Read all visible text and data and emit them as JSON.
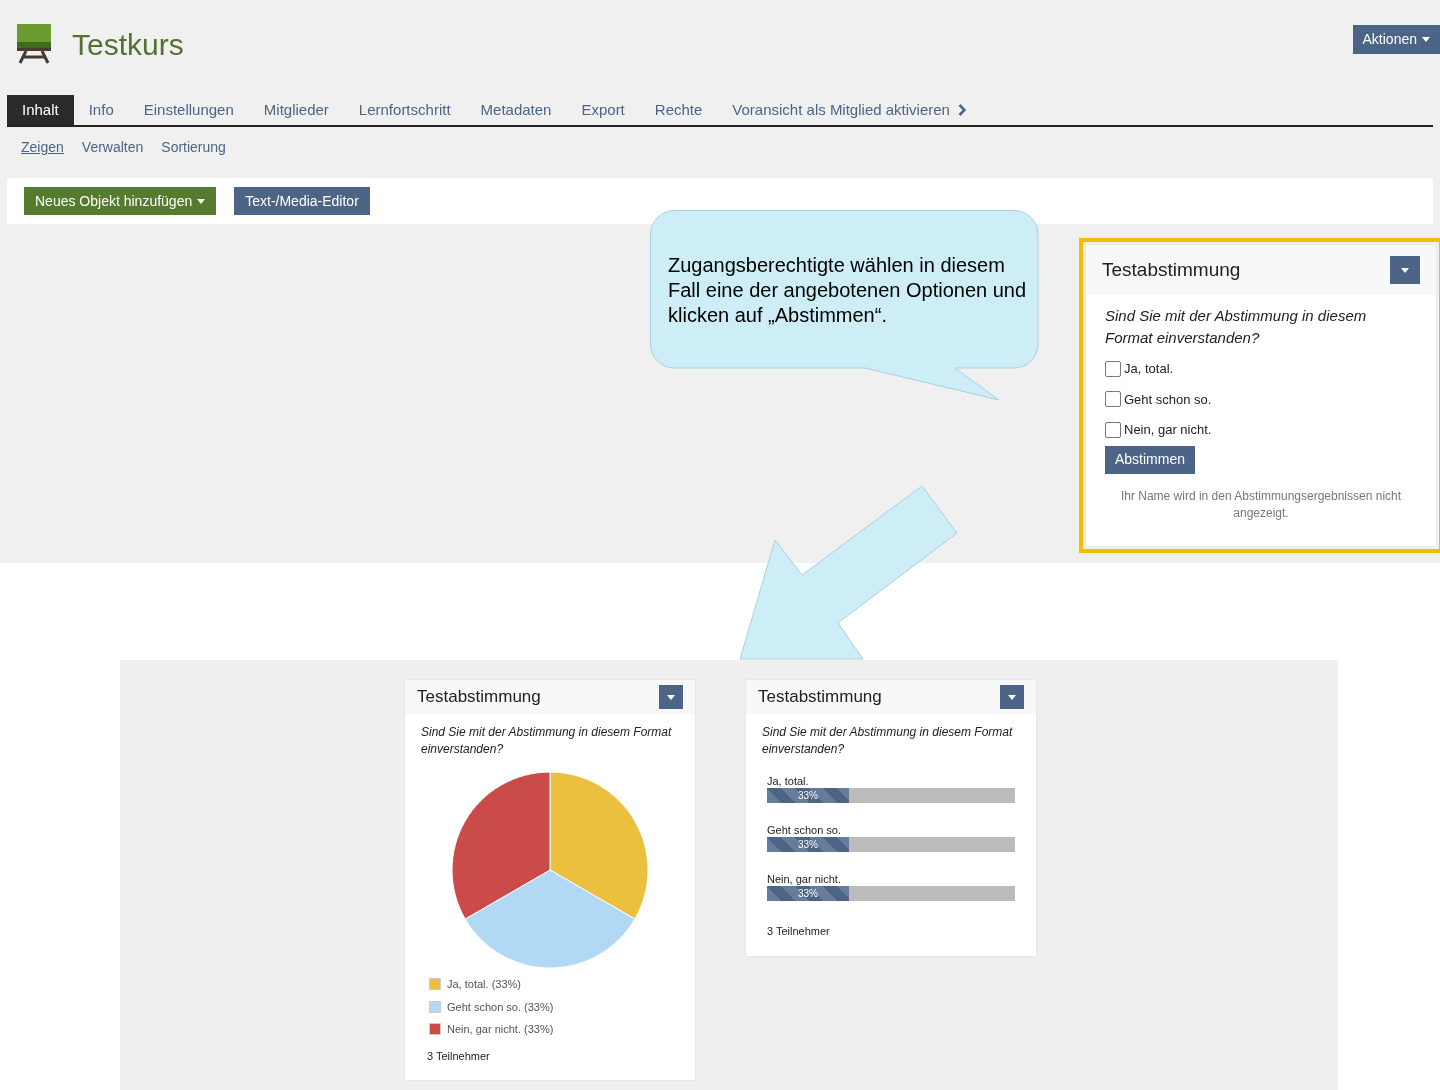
{
  "header": {
    "title": "Testkurs",
    "actions_button": "Aktionen"
  },
  "tabs": [
    {
      "label": "Inhalt",
      "selected": true,
      "kind": "tab"
    },
    {
      "label": "Info",
      "selected": false,
      "kind": "tab"
    },
    {
      "label": "Einstellungen",
      "selected": false,
      "kind": "tab"
    },
    {
      "label": "Mitglieder",
      "selected": false,
      "kind": "tab"
    },
    {
      "label": "Lernfortschritt",
      "selected": false,
      "kind": "tab"
    },
    {
      "label": "Metadaten",
      "selected": false,
      "kind": "tab"
    },
    {
      "label": "Export",
      "selected": false,
      "kind": "tab"
    },
    {
      "label": "Rechte",
      "selected": false,
      "kind": "tab"
    },
    {
      "label": "Voransicht als Mitglied aktivieren",
      "selected": false,
      "kind": "toggle"
    }
  ],
  "subtabs": [
    {
      "label": "Zeigen",
      "selected": true
    },
    {
      "label": "Verwalten",
      "selected": false
    },
    {
      "label": "Sortierung",
      "selected": false
    }
  ],
  "toolbar": [
    {
      "label": "Neues Objekt hinzufügen",
      "kind": "dropdown"
    },
    {
      "label": "Text-/Media-Editor",
      "kind": "plain"
    }
  ],
  "callout": {
    "text": "Zugangsberechtigte wählen in diesem Fall eine der angebotenen Optionen und klicken auf „Abstimmen“."
  },
  "poll_form": {
    "title": "Testabstimmung",
    "question": "Sind Sie mit der Abstimmung in diesem Format einverstanden?",
    "options": [
      {
        "label": "Ja, total.",
        "checked": false
      },
      {
        "label": "Geht schon so.",
        "checked": false
      },
      {
        "label": "Nein, gar nicht.",
        "checked": false
      }
    ],
    "submit": "Abstimmen",
    "note": "Ihr Name wird in den Abstimmungsergebnissen nicht angezeigt."
  },
  "results_pie": {
    "title": "Testabstimmung",
    "question": "Sind Sie mit der Abstimmung in diesem Format einverstanden?",
    "chart_data": {
      "type": "pie",
      "categories": [
        "Ja, total.",
        "Geht schon so.",
        "Nein, gar nicht."
      ],
      "values": [
        33,
        33,
        33
      ]
    },
    "legend": [
      {
        "share": "(33%)",
        "color": "#ebc03f"
      },
      {
        "share": "(33%)",
        "color": "#b1d8f5"
      },
      {
        "share": "(33%)",
        "color": "#cb4b4b"
      }
    ],
    "participants": "3 Teilnehmer"
  },
  "results_bars": {
    "title": "Testabstimmung",
    "question": "Sind Sie mit der Abstimmung in diesem Format einverstanden?",
    "options": [
      {
        "label": "Ja, total.",
        "level": 0.33,
        "reading": "33%"
      },
      {
        "label": "Geht schon so.",
        "level": 0.33,
        "reading": "33%"
      },
      {
        "label": "Nein, gar nicht.",
        "level": 0.33,
        "reading": "33%"
      }
    ],
    "participants": "3 Teilnehmer"
  }
}
